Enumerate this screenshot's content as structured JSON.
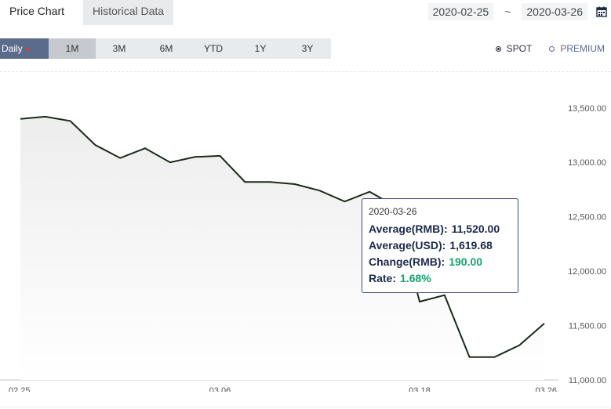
{
  "tabs": {
    "price_chart": "Price Chart",
    "historical": "Historical Data"
  },
  "date_range": {
    "start": "2020-02-25",
    "separator": "~",
    "end": "2020-03-26"
  },
  "icons": {
    "calendar": "calendar-icon",
    "dropdown": "caret-down-icon"
  },
  "ranges": {
    "daily": "Daily",
    "m1": "1M",
    "m3": "3M",
    "m6": "6M",
    "ytd": "YTD",
    "y1": "1Y",
    "y3": "3Y"
  },
  "price_type": {
    "spot": "SPOT",
    "premium": "PREMIUM",
    "selected": "SPOT"
  },
  "tooltip": {
    "date": "2020-03-26",
    "avg_rmb_label": "Average(RMB):",
    "avg_rmb": "11,520.00",
    "avg_usd_label": "Average(USD):",
    "avg_usd": "1,619.68",
    "change_label": "Change(RMB):",
    "change": "190.00",
    "rate_label": "Rate:",
    "rate": "1.68%"
  },
  "colors": {
    "line": "#1a2a1a",
    "positive": "#14a36b",
    "active_range": "#5b6b8c",
    "tooltip_border": "#3b4a7a"
  },
  "chart_data": {
    "type": "area",
    "x": [
      "02.25",
      "02.26",
      "02.27",
      "02.28",
      "03.02",
      "03.03",
      "03.04",
      "03.05",
      "03.06",
      "03.09",
      "03.10",
      "03.11",
      "03.12",
      "03.13",
      "03.16",
      "03.17",
      "03.18",
      "03.19",
      "03.20",
      "03.23",
      "03.24",
      "03.25",
      "03.26"
    ],
    "series": [
      {
        "values": [
          13400,
          13420,
          13380,
          13160,
          13040,
          13130,
          13000,
          13050,
          13060,
          12820,
          12820,
          12800,
          12740,
          12640,
          12730,
          12600,
          11720,
          11780,
          11210,
          11210,
          11320,
          11520
        ]
      }
    ],
    "x_tick_labels": [
      "02.25",
      "03.06",
      "03.18",
      "03.26"
    ],
    "y_ticks": [
      11000,
      11500,
      12000,
      12500,
      13000,
      13500
    ],
    "y_tick_labels": [
      "11,000.00",
      "11,500.00",
      "12,000.00",
      "12,500.00",
      "13,000.00",
      "13,500.00"
    ],
    "ylim": [
      11000,
      13700
    ],
    "grid": false
  }
}
